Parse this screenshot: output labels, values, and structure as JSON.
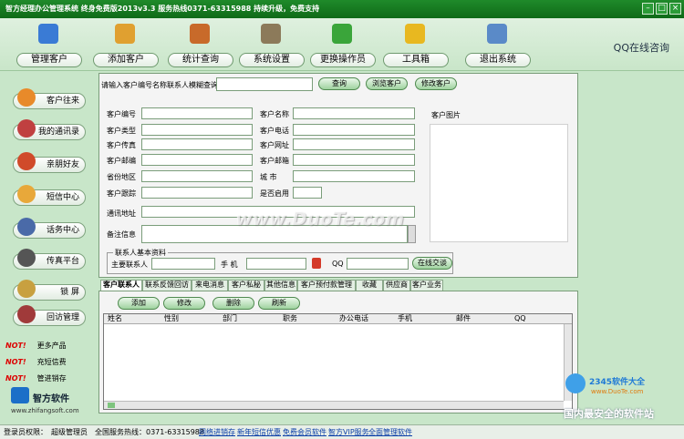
{
  "window": {
    "title": "智方经理办公管理系统 终身免费版2013v3.3    服务热线0371-63315988 持续升级，免费支持"
  },
  "toolbar": {
    "items": [
      {
        "label": "管理客户",
        "icon": "person-icon",
        "color": "#3a7bd5"
      },
      {
        "label": "添加客户",
        "icon": "add-customer-icon",
        "color": "#e0a030"
      },
      {
        "label": "统计查询",
        "icon": "stats-icon",
        "color": "#c86a2a"
      },
      {
        "label": "系统设置",
        "icon": "tools-icon",
        "color": "#8c7a5a"
      },
      {
        "label": "更换操作员",
        "icon": "operators-icon",
        "color": "#3aa53a"
      },
      {
        "label": "工具箱",
        "icon": "folder-icon",
        "color": "#e8b820"
      },
      {
        "label": "退出系统",
        "icon": "exit-icon",
        "color": "#5a8ac8"
      }
    ],
    "qq_label": "QQ在线咨询"
  },
  "sidebar": {
    "items": [
      {
        "label": "客户往来",
        "icon": "handshake-icon",
        "color": "#e88a2a"
      },
      {
        "label": "我的通讯录",
        "icon": "phonebook-icon",
        "color": "#c04040"
      },
      {
        "label": "亲朋好友",
        "icon": "friends-icon",
        "color": "#d04a2a"
      },
      {
        "label": "短信中心",
        "icon": "sms-icon",
        "color": "#e8a83a"
      },
      {
        "label": "话务中心",
        "icon": "phone-icon",
        "color": "#4a6aa8"
      },
      {
        "label": "传真平台",
        "icon": "fax-icon",
        "color": "#555555"
      },
      {
        "label": "锁    屏",
        "icon": "lock-icon",
        "color": "#c8a040"
      },
      {
        "label": "回访管理",
        "icon": "followup-icon",
        "color": "#a03a3a"
      }
    ],
    "hot_tag": "NOT!",
    "hot_items": [
      "更多产品",
      "充短信费",
      "管进销存"
    ],
    "logo_name": "智方软件",
    "logo_url": "www.zhifangsoft.com"
  },
  "search": {
    "label": "请输入客户编号名称联系人模糊查询",
    "value": "",
    "buttons": [
      "查询",
      "浏览客户",
      "修改客户"
    ]
  },
  "form": {
    "left_fields": [
      "客户编号",
      "客户类型",
      "客户传真",
      "客户邮编",
      "省份地区",
      "客户跟踪"
    ],
    "right_fields": [
      "客户名称",
      "客户电话",
      "客户网址",
      "客户邮箱",
      "城    市",
      "是否启用"
    ],
    "address_label": "通讯地址",
    "memo_label": "备注信息",
    "photo_label": "客户图片"
  },
  "contact": {
    "legend": "联系人基本资料",
    "main_label": "主要联系人",
    "phone_label": "手  机",
    "qq_label": "QQ",
    "talk_button": "在线交谈"
  },
  "tabs": [
    "客户联系人",
    "联系反馈回访",
    "来电消息",
    "客户私秘",
    "其他信息",
    "客户预付款管理",
    "收藏",
    "供应商",
    "客户业务"
  ],
  "grid": {
    "buttons": [
      "添加",
      "修改",
      "删除",
      "刷新"
    ],
    "columns": [
      "姓名",
      "性别",
      "部门",
      "职务",
      "办公电话",
      "手机",
      "邮件",
      "QQ"
    ]
  },
  "status": {
    "login_label": "登录员权限：",
    "role": "超级管理员",
    "hotline": "全国服务热线：0371-63315988",
    "links": [
      "网络进销存",
      "新年短信优惠",
      "免费会员软件",
      "智方VIP服务",
      "全面管理软件"
    ]
  },
  "watermarks": {
    "center": "www.DuoTe.com",
    "brand": "2345软件大全",
    "brand_url": "www.DuoTe.com",
    "slogan": "国内最安全的软件站"
  }
}
